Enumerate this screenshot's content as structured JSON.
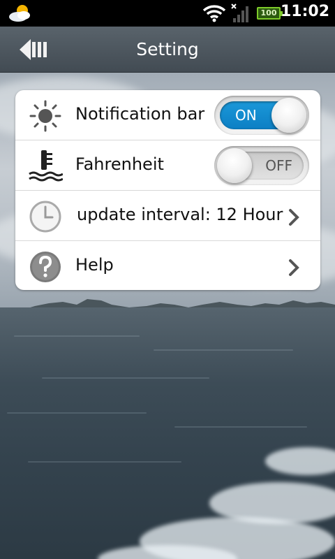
{
  "status_bar": {
    "time": "11:02",
    "battery_level": "100",
    "icons": [
      "weather-icon",
      "wifi-icon",
      "signal-icon",
      "battery-icon"
    ]
  },
  "header": {
    "title": "Setting",
    "back_icon": "back-arrow-icon"
  },
  "settings": {
    "items": [
      {
        "label": "Notification bar",
        "icon": "sun-icon",
        "control": "toggle",
        "state": true,
        "toggle_text": "ON"
      },
      {
        "label": "Fahrenheit",
        "icon": "thermometer-icon",
        "control": "toggle",
        "state": false,
        "toggle_text": "OFF"
      },
      {
        "label": "update interval: 12 Hour",
        "icon": "clock-icon",
        "control": "chevron"
      },
      {
        "label": "Help",
        "icon": "help-icon",
        "control": "chevron"
      }
    ]
  },
  "colors": {
    "toggle_on": "#1b98d9",
    "title_bar": "#4d575f",
    "status_bar": "#000000",
    "battery": "#7ecb2a"
  }
}
